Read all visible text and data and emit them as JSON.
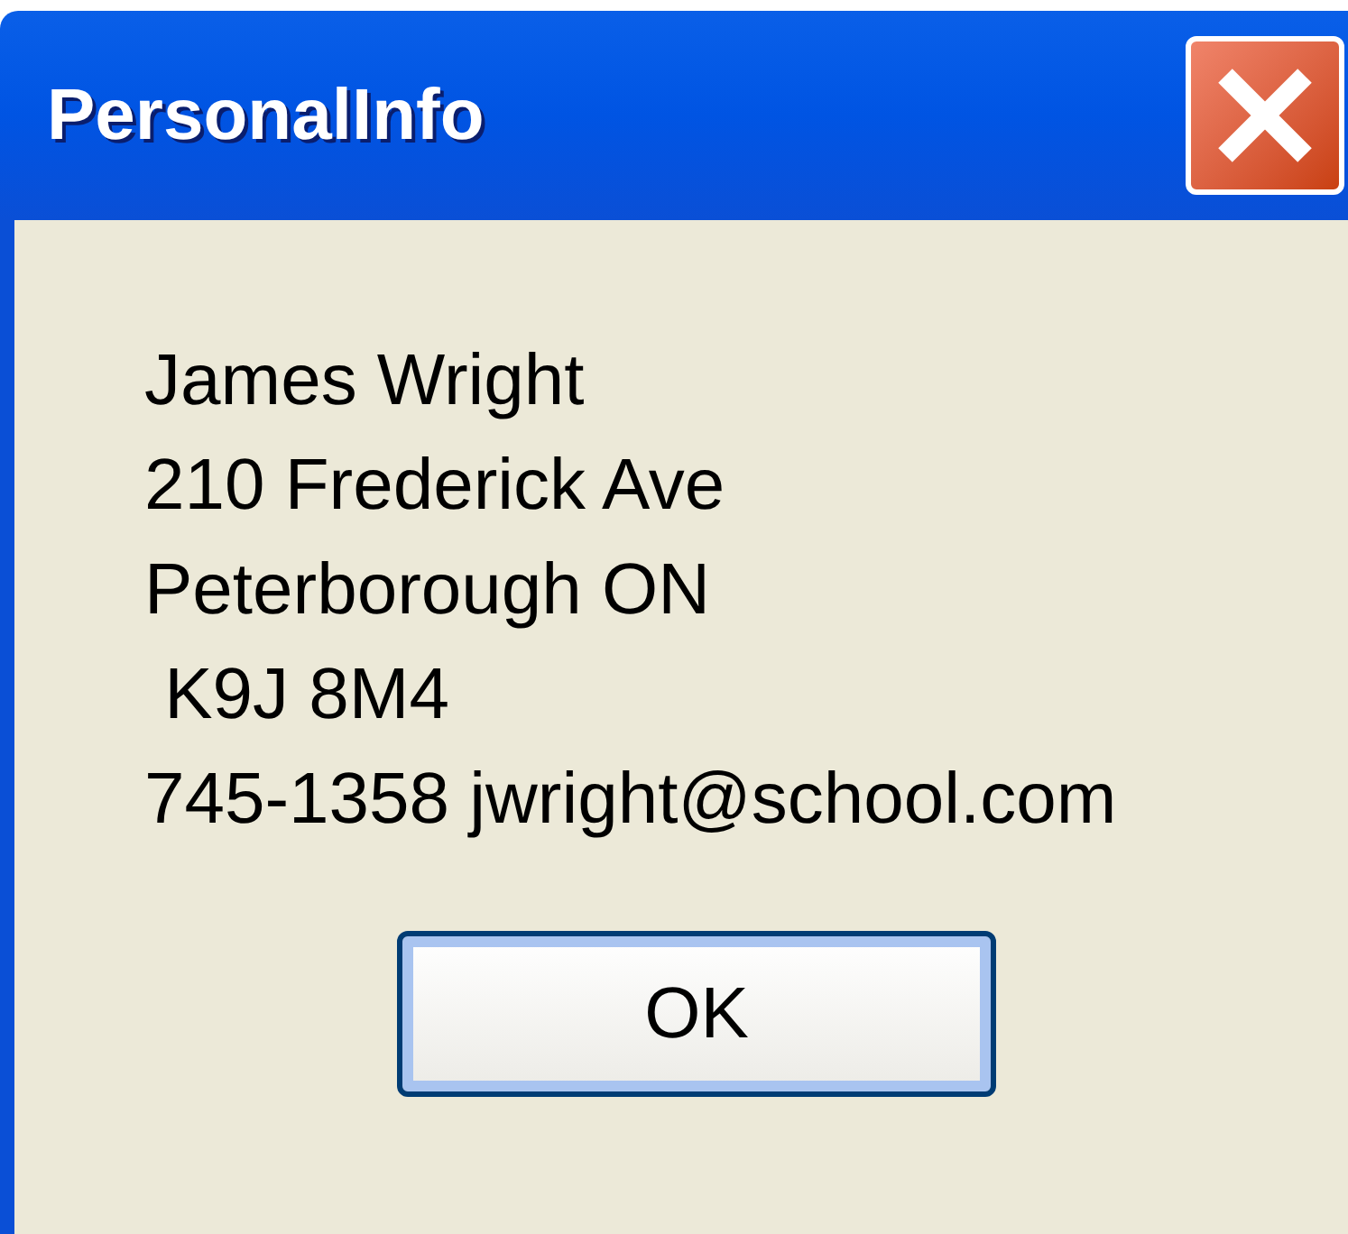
{
  "window": {
    "title": "PersonalInfo"
  },
  "message_lines": [
    "James Wright",
    "210 Frederick Ave",
    "Peterborough ON",
    " K9J 8M4",
    "745-1358 jwright@school.com"
  ],
  "buttons": [
    "OK"
  ]
}
